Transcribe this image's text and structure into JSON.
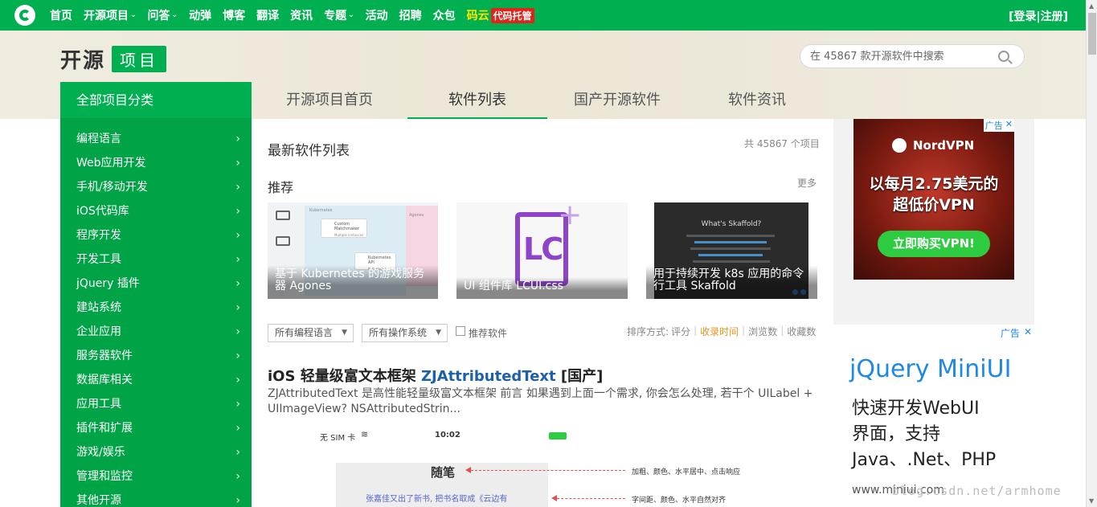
{
  "nav": {
    "items": [
      {
        "label": "首页",
        "dropdown": false
      },
      {
        "label": "开源项目",
        "dropdown": true
      },
      {
        "label": "问答",
        "dropdown": true
      },
      {
        "label": "动弹",
        "dropdown": false
      },
      {
        "label": "博客",
        "dropdown": false
      },
      {
        "label": "翻译",
        "dropdown": false
      },
      {
        "label": "资讯",
        "dropdown": false
      },
      {
        "label": "专题",
        "dropdown": true
      },
      {
        "label": "活动",
        "dropdown": false
      },
      {
        "label": "招聘",
        "dropdown": false
      },
      {
        "label": "众包",
        "dropdown": false
      }
    ],
    "mayun": "码云",
    "tuoguan": "代码托管",
    "login": "[登录|注册]",
    "dropdown_glyph": "⌄"
  },
  "brand": {
    "part1": "开源",
    "part2": "项目"
  },
  "search": {
    "placeholder": "在 45867 款开源软件中搜索"
  },
  "sidebar": {
    "header": "全部项目分类",
    "chevron": "›",
    "items": [
      "编程语言",
      "Web应用开发",
      "手机/移动开发",
      "iOS代码库",
      "程序开发",
      "开发工具",
      "jQuery 插件",
      "建站系统",
      "企业应用",
      "服务器软件",
      "数据库相关",
      "应用工具",
      "插件和扩展",
      "游戏/娱乐",
      "管理和监控",
      "其他开源"
    ]
  },
  "tabs": [
    "开源项目首页",
    "软件列表",
    "国产开源软件",
    "软件资讯"
  ],
  "main": {
    "list_title": "最新软件列表",
    "count": "共 45867 个项目",
    "rec_title": "推荐",
    "more": "更多",
    "cards": [
      {
        "caption": "基于 Kubernetes 的游戏服务器 Agones"
      },
      {
        "caption": "UI 组件库 LCUI.css",
        "logo": "LC"
      },
      {
        "caption": "用于持续开发 k8s 应用的命令行工具 Skaffold",
        "heading": "What's Skaffold?"
      }
    ],
    "card1_texts": {
      "k8s": "Kubernetes",
      "ops": "Agones",
      "b1": "Custom Matchmaker",
      "b1s": "Multiple Instances",
      "b2": "Kubernetes API",
      "b2s": "Kubernetes"
    },
    "filters": {
      "lang": "所有编程语言",
      "os": "所有操作系统",
      "recommend": "推荐软件",
      "arrow": "▼"
    },
    "sort": {
      "label": "排序方式:",
      "options": [
        "评分",
        "收录时间",
        "浏览数",
        "收藏数"
      ],
      "active_index": 1
    },
    "article": {
      "title_prefix": "iOS 轻量级富文本框架",
      "title_link": "ZJAttributedText",
      "title_suffix": "[国产]",
      "desc": "ZJAttributedText 是高性能轻量级富文本框架 前言 如果遇到上面一个需求, 你会怎么处理, 若干个 UILabel + UIImageView? NSAttributedStrin..."
    },
    "mock": {
      "carrier": "无 SIM 卡",
      "time": "10:02",
      "heading": "随笔",
      "line": "张嘉佳又出了新书, 把书名取成《云边有",
      "note1": "加粗、颜色、水平居中、点击响应",
      "note2": "字间距、颜色、水平自然对齐"
    }
  },
  "ads": {
    "badge": "广告",
    "close": "✕",
    "nord": {
      "brand": "NordVPN",
      "line1": "以每月2.75美元的",
      "line2": "超低价VPN",
      "button": "立即购买VPN!"
    },
    "miniui": {
      "headline": "jQuery MiniUI",
      "line1": "快速开发WebUI",
      "line2": "界面，支持",
      "line3": "Java、.Net、PHP",
      "url": "www.miniui.com"
    }
  },
  "watermark": "blog.csdn.net/armhome",
  "colors": {
    "brand_green": "#00b050",
    "sidebar_green": "#00a346",
    "accent_orange": "#e8941f",
    "link_blue": "#1d5fa8"
  }
}
